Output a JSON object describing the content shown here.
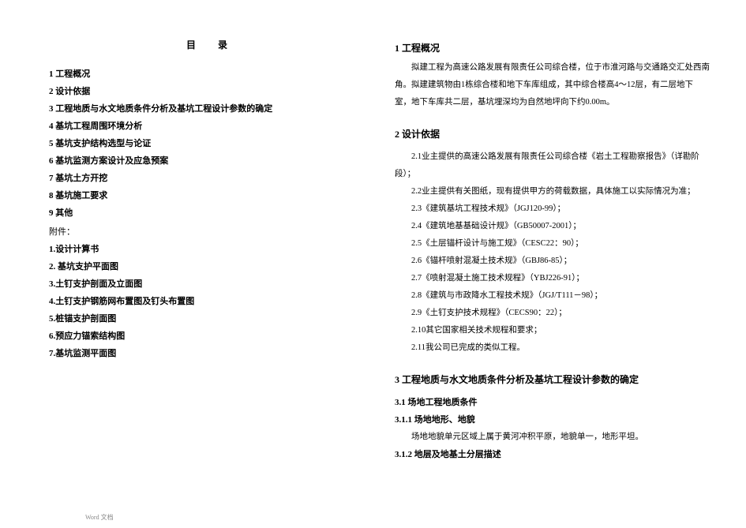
{
  "title": {
    "char1": "目",
    "char2": "录"
  },
  "toc": [
    "1  工程概况",
    "2  设计依据",
    "3  工程地质与水文地质条件分析及基坑工程设计参数的确定",
    "4  基坑工程周围环境分析",
    "5  基坑支护结构选型与论证",
    "6  基坑监测方案设计及应急预案",
    "7  基坑土方开挖",
    "8  基坑施工要求",
    "9  其他"
  ],
  "attachments_header": "附件：",
  "attachments": [
    "1.设计计算书",
    "2.  基坑支护平面图",
    "3.土钉支护剖面及立面图",
    "4.土钉支护钢筋网布置图及钉头布置图",
    "5.桩锚支护剖面图",
    "6.预应力锚索结构图",
    "7.基坑监测平面图"
  ],
  "section1": {
    "heading": "1  工程概况",
    "lines": [
      "拟建工程为高速公路发展有限责任公司综合楼，位于市淮河路与交通路交汇处西南",
      "角。拟建建筑物由1栋综合楼和地下车库组成，其中综合楼高4～12层，有二层地下",
      "室，地下车库共二层，基坑埋深均为自然地坪向下约0.00m。"
    ]
  },
  "section2": {
    "heading": "2  设计依据",
    "items": [
      "2.1业主提供的高速公路发展有限责任公司综合楼《岩土工程勘察报告》（详勘阶段）；",
      "2.2业主提供有关图纸，现有提供甲方的荷载数据，具体施工以实际情况为准；",
      "2.3《建筑基坑工程技术规》（JGJ120-99）；",
      "2.4《建筑地基基础设计规》（GB50007-2001）；",
      "2.5《土层锚杆设计与施工规》（CESC22：90）；",
      "2.6《锚杆喷射混凝土技术规》（GBJ86-85）；",
      "2.7《喷射混凝土施工技术规程》（YBJ226-91）；",
      "2.8《建筑与市政降水工程技术规》（JGJ/T111－98）；",
      "2.9《土钉支护技术规程》（CECS90：22）；",
      "2.10其它国家相关技术规程和要求；",
      "2.11我公司已完成的类似工程。"
    ]
  },
  "section3": {
    "heading": "3  工程地质与水文地质条件分析及基坑工程设计参数的确定",
    "s31": "3.1 场地工程地质条件",
    "s311": "3.1.1 场地地形、地貌",
    "s311_body": "场地地貌单元区域上属于黄河冲积平原，地貌单一，地形平坦。",
    "s312": "3.1.2 地层及地基土分层描述"
  },
  "footer": "Word  文档"
}
